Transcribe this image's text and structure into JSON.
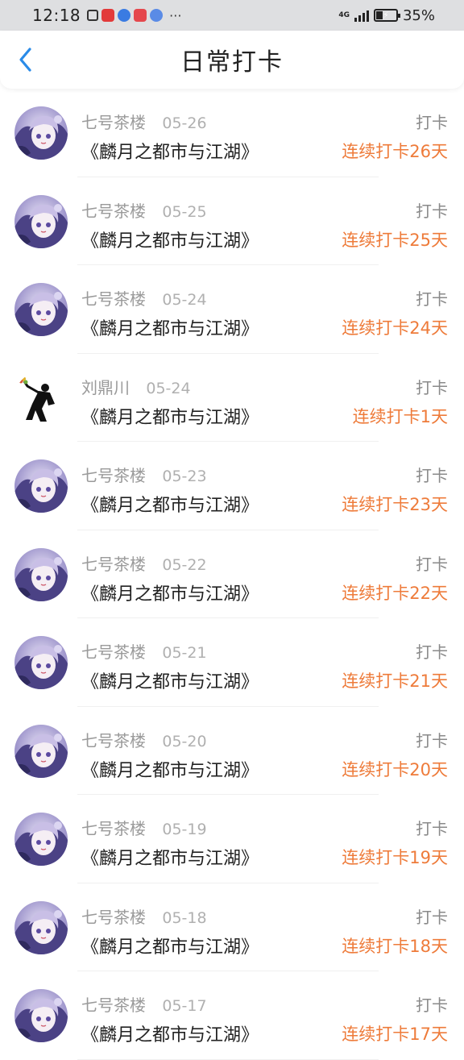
{
  "status_bar": {
    "time": "12:18",
    "network": "4G",
    "battery_percent": "35%",
    "battery_level": 0.35,
    "icons": [
      "tv-icon",
      "book-app-icon",
      "browser-icon",
      "huawei-app-icon",
      "music-icon",
      "more-dots-icon"
    ],
    "dots": "···"
  },
  "header": {
    "title": "日常打卡",
    "back_icon": "chevron-left-icon"
  },
  "colors": {
    "accent_blue": "#2a8be8",
    "streak_orange": "#ee7b3a",
    "status_bar_bg": "#dedfe1"
  },
  "checkins": [
    {
      "user": "七号茶楼",
      "date": "05-26",
      "action": "打卡",
      "book": "《麟月之都市与江湖》",
      "streak": "连续打卡26天",
      "avatar": "anime"
    },
    {
      "user": "七号茶楼",
      "date": "05-25",
      "action": "打卡",
      "book": "《麟月之都市与江湖》",
      "streak": "连续打卡25天",
      "avatar": "anime"
    },
    {
      "user": "七号茶楼",
      "date": "05-24",
      "action": "打卡",
      "book": "《麟月之都市与江湖》",
      "streak": "连续打卡24天",
      "avatar": "anime"
    },
    {
      "user": "刘鼎川",
      "date": "05-24",
      "action": "打卡",
      "book": "《麟月之都市与江湖》",
      "streak": "连续打卡1天",
      "avatar": "flower-thrower"
    },
    {
      "user": "七号茶楼",
      "date": "05-23",
      "action": "打卡",
      "book": "《麟月之都市与江湖》",
      "streak": "连续打卡23天",
      "avatar": "anime"
    },
    {
      "user": "七号茶楼",
      "date": "05-22",
      "action": "打卡",
      "book": "《麟月之都市与江湖》",
      "streak": "连续打卡22天",
      "avatar": "anime"
    },
    {
      "user": "七号茶楼",
      "date": "05-21",
      "action": "打卡",
      "book": "《麟月之都市与江湖》",
      "streak": "连续打卡21天",
      "avatar": "anime"
    },
    {
      "user": "七号茶楼",
      "date": "05-20",
      "action": "打卡",
      "book": "《麟月之都市与江湖》",
      "streak": "连续打卡20天",
      "avatar": "anime"
    },
    {
      "user": "七号茶楼",
      "date": "05-19",
      "action": "打卡",
      "book": "《麟月之都市与江湖》",
      "streak": "连续打卡19天",
      "avatar": "anime"
    },
    {
      "user": "七号茶楼",
      "date": "05-18",
      "action": "打卡",
      "book": "《麟月之都市与江湖》",
      "streak": "连续打卡18天",
      "avatar": "anime"
    },
    {
      "user": "七号茶楼",
      "date": "05-17",
      "action": "打卡",
      "book": "《麟月之都市与江湖》",
      "streak": "连续打卡17天",
      "avatar": "anime"
    }
  ]
}
